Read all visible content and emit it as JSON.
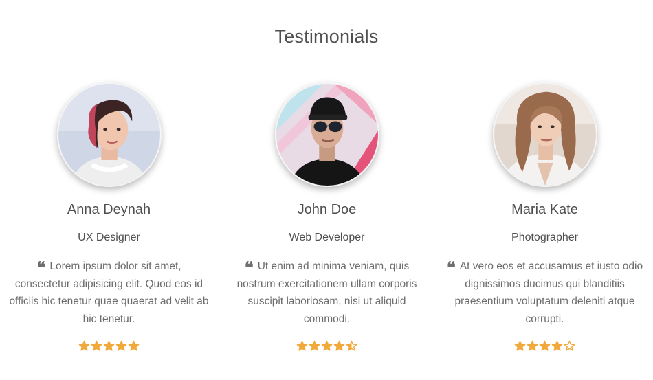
{
  "section": {
    "title": "Testimonials"
  },
  "testimonials": [
    {
      "name": "Anna Deynah",
      "role": "UX Designer",
      "quote": "Lorem ipsum dolor sit amet, consectetur adipisicing elit. Quod eos id officiis hic tenetur quae quaerat ad velit ab hic tenetur.",
      "rating": 5,
      "avatar_icon": "portrait-woman-short-hair"
    },
    {
      "name": "John Doe",
      "role": "Web Developer",
      "quote": "Ut enim ad minima veniam, quis nostrum exercitationem ullam corporis suscipit laboriosam, nisi ut aliquid commodi.",
      "rating": 4.5,
      "avatar_icon": "portrait-man-cap-sunglasses"
    },
    {
      "name": "Maria Kate",
      "role": "Photographer",
      "quote": "At vero eos et accusamus et iusto odio dignissimos ducimus qui blanditiis praesentium voluptatum deleniti atque corrupti.",
      "rating": 4,
      "avatar_icon": "portrait-woman-long-hair"
    }
  ],
  "colors": {
    "star": "#f2a93b",
    "text": "#4f4f4f",
    "quote_text": "#6c6c6c"
  },
  "icons": {
    "quote": "quote-left-icon",
    "star_full": "star-full-icon",
    "star_half": "star-half-icon",
    "star_empty": "star-empty-icon"
  }
}
